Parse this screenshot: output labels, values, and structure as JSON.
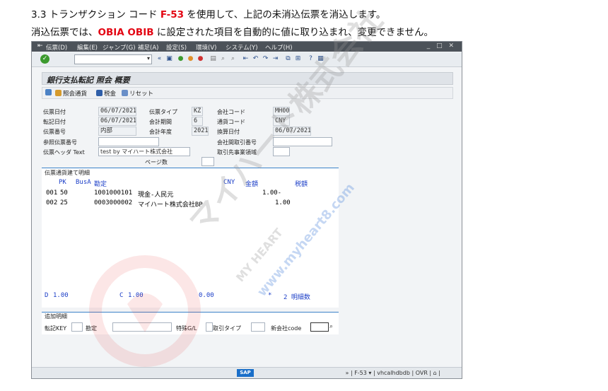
{
  "doc": {
    "line1_pre": "3.3 トランザクション コード ",
    "line1_code": "F-53",
    "line1_post": " を使用して、上記の未消込伝票を消込します。",
    "line2_pre": "消込伝票では、",
    "line2_fields": "OBIA OBIB",
    "line2_post": " に設定された項目を自動的に値に取り込まれ、変更できません。"
  },
  "menu": [
    "伝票(D)",
    "編集(E)",
    "ジャンプ(G)",
    "補足(A)",
    "設定(S)",
    "環境(V)",
    "システム(Y)",
    "ヘルプ(H)"
  ],
  "title": "銀行支払転記 照会 概要",
  "app_toolbar": {
    "display_currency": "照会通貨",
    "tax": "税金",
    "reset": "リセット"
  },
  "header": {
    "doc_date_label": "伝票日付",
    "doc_date": "06/07/2021",
    "doc_type_label": "伝票タイプ",
    "doc_type": "KZ",
    "company_label": "会社コード",
    "company": "MH00",
    "post_date_label": "転記日付",
    "post_date": "06/07/2021",
    "period_label": "会計期間",
    "period": "6",
    "currency_label": "通貨コード",
    "currency": "CNY",
    "doc_no_label": "伝票番号",
    "doc_no": "内部",
    "fiscal_year_label": "会計年度",
    "fiscal_year": "2021",
    "trans_date_label": "換算日付",
    "trans_date": "06/07/2021",
    "ref_label": "参照伝票番号",
    "ref": "",
    "intercompany_label": "会社間取引番号",
    "intercompany": "",
    "header_text_label": "伝票ヘッダ Text",
    "header_text": "test by マイハート株式会社",
    "trading_partner_label": "取引先事業領域",
    "trading_partner": "",
    "page_count_label": "ページ数",
    "page_count": ""
  },
  "items": {
    "group_title": "伝票通貨建て明細",
    "col_pk": "PK",
    "col_busa": "BusA",
    "col_account": "勘定",
    "col_currency": "CNY",
    "col_amount": "金額",
    "col_tax": "税額",
    "rows": [
      {
        "line": "001",
        "pk": "50",
        "account": "1001000101",
        "name": "現金-人民元",
        "amount": "1.00-"
      },
      {
        "line": "002",
        "pk": "25",
        "account": "0003000002",
        "name": "マイハート株式会社BP",
        "amount": "1.00"
      }
    ],
    "total_d_label": "D",
    "total_d": "1.00",
    "total_c_label": "C",
    "total_c": "1.00",
    "balance": "0.00",
    "star": "*",
    "line_count": "2 明細数"
  },
  "additional": {
    "group_title": "追加明細",
    "posting_key_label": "転記KEY",
    "account_label": "勘定",
    "sp_gl_label": "特殊G/L",
    "trans_type_label": "取引タイプ",
    "new_company_label": "新会社code"
  },
  "status": {
    "sap_logo": "SAP",
    "tcode": "F-53",
    "server": "vhcalhdbdb",
    "mode": "OVR"
  },
  "watermark": {
    "company": "マイハート株式会社",
    "brand": "MY HEART",
    "url": "www.myheart8.com"
  },
  "colors": {
    "accent": "#e30613",
    "sap_blue": "#1e40c8",
    "menubar": "#4c5259"
  }
}
